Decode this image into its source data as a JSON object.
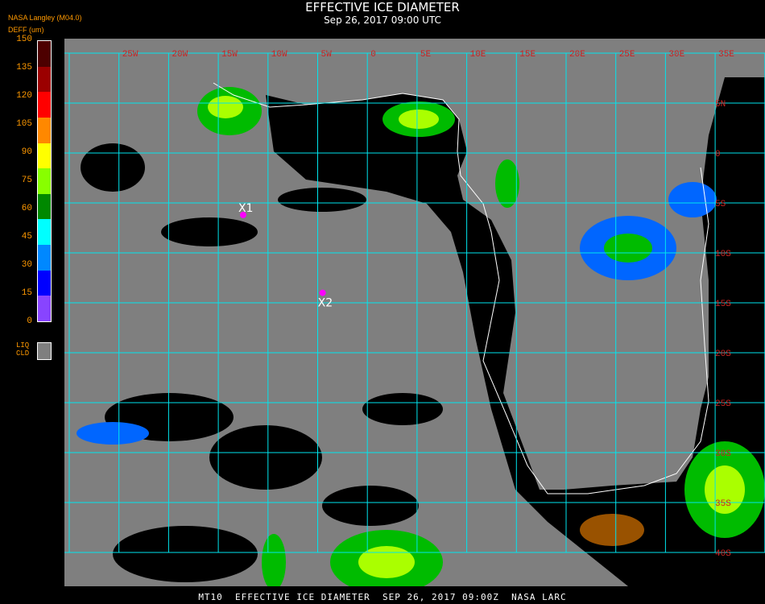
{
  "header": {
    "title": "EFFECTIVE ICE DIAMETER",
    "subtitle": "Sep 26, 2017 09:00 UTC",
    "org": "NASA Langley (M04.0)",
    "unit": "DEFF (um)"
  },
  "colorbar": {
    "ticks": [
      "150",
      "135",
      "120",
      "105",
      "90",
      "75",
      "60",
      "45",
      "30",
      "15",
      "0"
    ],
    "colors": [
      "#4d0000",
      "#9b0000",
      "#ff0000",
      "#ff8800",
      "#ffff00",
      "#88ff00",
      "#008800",
      "#00ffff",
      "#0088ff",
      "#0000ff",
      "#8844ff"
    ],
    "liquid_label": [
      "LIQ",
      "CLD"
    ],
    "liquid_color": "#7f7f7f"
  },
  "map": {
    "lat_labels": [
      "5N",
      "0",
      "5S",
      "10S",
      "15S",
      "20S",
      "25S",
      "30S",
      "35S",
      "40S"
    ],
    "lon_labels": [
      "25W",
      "20W",
      "15W",
      "10W",
      "5W",
      "0",
      "5E",
      "10E",
      "15E",
      "20E",
      "25E",
      "30E",
      "35E"
    ],
    "markers": [
      {
        "label": "X1",
        "lon": -12.5,
        "lat": -6.2
      },
      {
        "label": "X2",
        "lon": -4.5,
        "lat": -14.0
      }
    ],
    "colors": {
      "grid": "#00e5ee",
      "land": "#000000",
      "cloud": "#7f7f7f",
      "coast": "#ffffff",
      "label": "#cc2222",
      "marker": "#ff00ff"
    }
  },
  "footer": "MT10  EFFECTIVE ICE DIAMETER  SEP 26, 2017 09:00Z  NASA LARC"
}
